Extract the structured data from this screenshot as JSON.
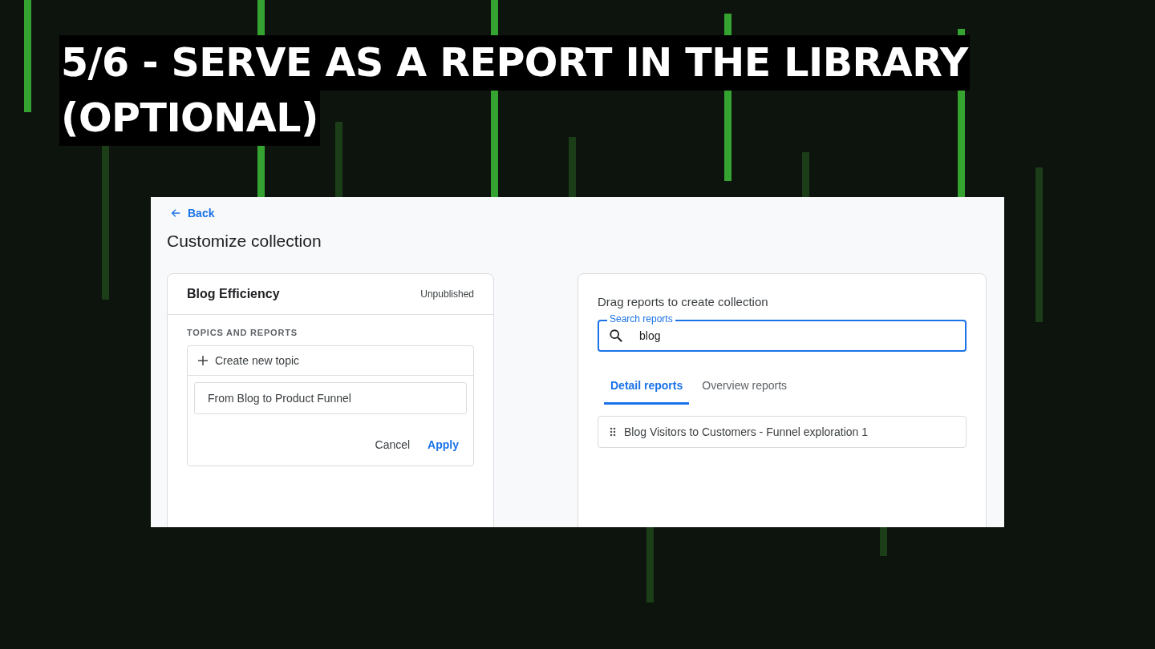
{
  "slide": {
    "title_lines": [
      "5/6 - SERVE AS A REPORT IN THE LIBRARY",
      "(OPTIONAL)"
    ]
  },
  "screen": {
    "back_link": "Back",
    "title": "Customize collection",
    "collection_card": {
      "name": "Blog Efficiency",
      "status": "Unpublished",
      "section_label": "TOPICS AND REPORTS",
      "create_topic": "Create new topic",
      "topic_field": {
        "value": "From Blog to Product Funnel"
      },
      "buttons": [
        {
          "label": "Cancel",
          "kind": "secondary"
        },
        {
          "label": "Apply",
          "kind": "primary"
        }
      ]
    },
    "reports_card": {
      "heading": "Drag reports to create collection",
      "search": {
        "label": "Search reports",
        "value": "blog"
      },
      "tabs": [
        {
          "label": "Detail reports",
          "selected": true
        },
        {
          "label": "Overview reports",
          "selected": false
        }
      ],
      "reports": [
        "Blog Visitors to Customers - Funnel exploration 1"
      ]
    }
  }
}
